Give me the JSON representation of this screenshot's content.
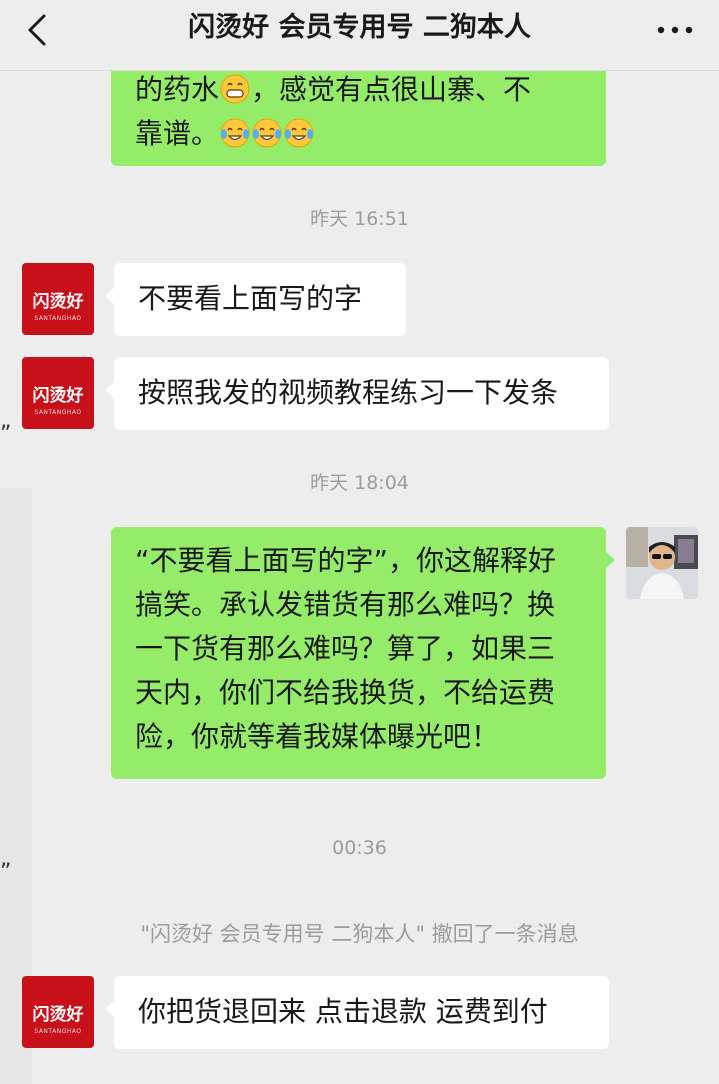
{
  "header": {
    "title": "闪烫好  会员专用号 二狗本人",
    "back_icon": "chevron-left-icon",
    "more_icon": "more-dots-icon"
  },
  "avatars": {
    "shop": {
      "brand_text": "闪烫好",
      "brand_sub": "SANTANGHAO",
      "color": "#c8101a"
    },
    "me": {
      "icon": "user-photo-avatar"
    }
  },
  "messages": {
    "m0_line1": "的药水",
    "m0_line1b": "，感觉有点很山寨、不",
    "m0_line2": "靠谱。",
    "time1": "昨天 16:51",
    "m1": "不要看上面写的字",
    "m2": "按照我发的视频教程练习一下发条",
    "time2": "昨天 18:04",
    "m3": "“不要看上面写的字”，你这解释好搞笑。承认发错货有那么难吗？换一下货有那么难吗？算了，如果三天内，你们不给我换货，不给运费险，你就等着我媒体曝光吧！",
    "time3": "00:36",
    "recall": "\"闪烫好  会员专用号 二狗本人\" 撤回了一条消息",
    "m4": "你把货退回来 点击退款 运费到付"
  },
  "colors": {
    "background": "#ededed",
    "outgoing_bubble": "#95ec69",
    "incoming_bubble": "#ffffff",
    "timestamp": "#9c9c9c"
  }
}
